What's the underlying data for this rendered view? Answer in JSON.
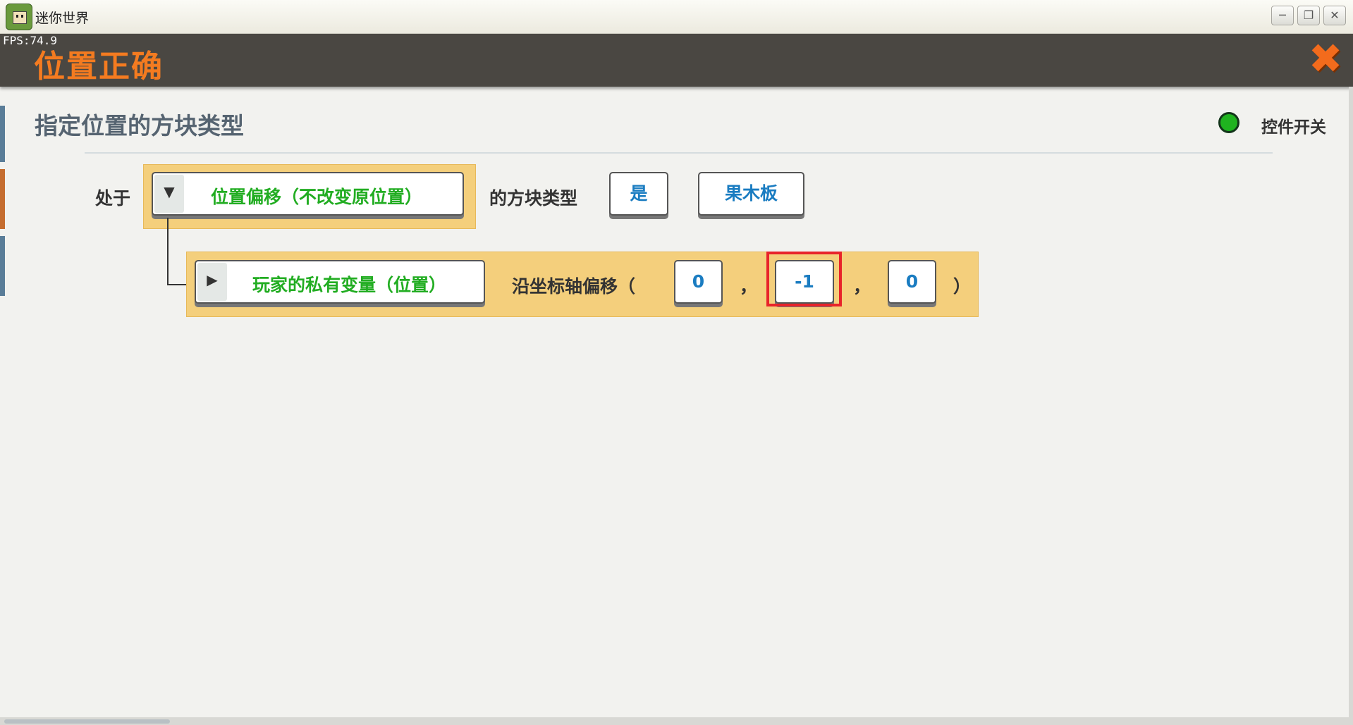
{
  "window": {
    "title": "迷你世界",
    "app_icon": "game-app-icon",
    "controls": {
      "minimize": "─",
      "maximize": "❐",
      "close": "✕"
    }
  },
  "overlay": {
    "fps": "FPS:74.9"
  },
  "header": {
    "title": "位置正确",
    "close_icon": "✖"
  },
  "section": {
    "title": "指定位置的方块类型",
    "toggle_label": "控件开关",
    "toggle_color": "#1fb31f"
  },
  "row1": {
    "prefix": "处于",
    "dropdown_arrow": "▼",
    "dropdown_label": "位置偏移（不改变原位置）",
    "middle_text": "的方块类型",
    "is_value": "是",
    "block_value": "果木板"
  },
  "row2": {
    "dropdown_arrow": "▶",
    "dropdown_label": "玩家的私有变量（位置）",
    "offset_label": "沿坐标轴偏移（",
    "x_value": "0",
    "sep1": "，",
    "y_value": "-1",
    "sep2": "，",
    "z_value": "0",
    "close_paren": "）"
  },
  "colors": {
    "header_bg": "#4a4742",
    "title_orange": "#f47b20",
    "block_yellow": "#f4cf7c",
    "param_green": "#22ad22",
    "value_blue": "#1a7cc1",
    "highlight_red": "#e8232a"
  }
}
